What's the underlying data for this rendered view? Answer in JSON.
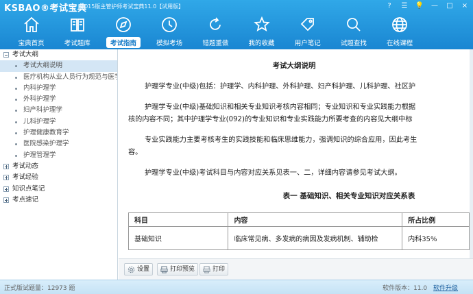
{
  "app": {
    "logo": "KSBAO®考试宝典",
    "window_title": "2015版主管护师考试宝典11.0【试用版】"
  },
  "window_controls": [
    "?",
    "☰",
    "💡",
    "—",
    "□",
    "×"
  ],
  "nav": [
    {
      "label": "宝典首页",
      "icon": "home-icon",
      "active": false
    },
    {
      "label": "考试题库",
      "icon": "book-icon",
      "active": false
    },
    {
      "label": "考试指南",
      "icon": "compass-icon",
      "active": true
    },
    {
      "label": "模拟考场",
      "icon": "clock-icon",
      "active": false
    },
    {
      "label": "错题重做",
      "icon": "redo-icon",
      "active": false
    },
    {
      "label": "我的收藏",
      "icon": "star-icon",
      "active": false
    },
    {
      "label": "用户笔记",
      "icon": "tag-icon",
      "active": false
    },
    {
      "label": "试题查找",
      "icon": "search-icon",
      "active": false
    },
    {
      "label": "在线课程",
      "icon": "globe-icon",
      "active": false
    }
  ],
  "tree": [
    {
      "label": "考试大纲",
      "level": 0,
      "expanded": true
    },
    {
      "label": "考试大纲说明",
      "level": 1,
      "selected": true
    },
    {
      "label": "医疗机构从业人员行为规范与医学伦理学",
      "level": 1
    },
    {
      "label": "内科护理学",
      "level": 1
    },
    {
      "label": "外科护理学",
      "level": 1
    },
    {
      "label": "妇产科护理学",
      "level": 1
    },
    {
      "label": "儿科护理学",
      "level": 1
    },
    {
      "label": "护理健康教育学",
      "level": 1
    },
    {
      "label": "医院感染护理学",
      "level": 1
    },
    {
      "label": "护理管理学",
      "level": 1
    },
    {
      "label": "考试动态",
      "level": 0,
      "expanded": false
    },
    {
      "label": "考试经验",
      "level": 0,
      "expanded": false
    },
    {
      "label": "知识点笔记",
      "level": 0,
      "expanded": false
    },
    {
      "label": "考点速记",
      "level": 0,
      "expanded": false
    }
  ],
  "document": {
    "title": "考试大纲说明",
    "paragraphs": [
      "护理学专业(中级)包括：护理学、内科护理、外科护理、妇产科护理、儿科护理、社区护",
      "护理学专业(中级)基础知识和相关专业知识考核内容相同；专业知识和专业实践能力根据",
      "核的内容不同；其中护理学专业(092)的专业知识和专业实践能力所要考查的内容见大纲中标",
      "专业实践能力主要考核考生的实践技能和临床思维能力，强调知识的综合应用，因此考生",
      "容。",
      "护理学专业(中级)考试科目与内容对应关系见表一、二，详细内容请参见考试大纲。"
    ],
    "table_title": "表一 基础知识、相关专业知识对应关系表",
    "table_headers": [
      "科目",
      "内容",
      "所占比例"
    ],
    "table_rows": [
      [
        "基础知识",
        "临床常见病、多发病的病因及发病机制、辅助检",
        "内科35%"
      ]
    ]
  },
  "toolbar": {
    "settings": "设置",
    "print_preview": "打印预览",
    "print": "打印"
  },
  "status": {
    "question_count": "正式版试题量：12973 题",
    "version": "软件版本：11.0",
    "upgrade": "软件升级"
  },
  "colors": {
    "header_top": "#30a8e8",
    "header_bottom": "#1a86d2",
    "selected_row": "#d4e6f5",
    "active_tab_text": "#1b7ec9"
  }
}
